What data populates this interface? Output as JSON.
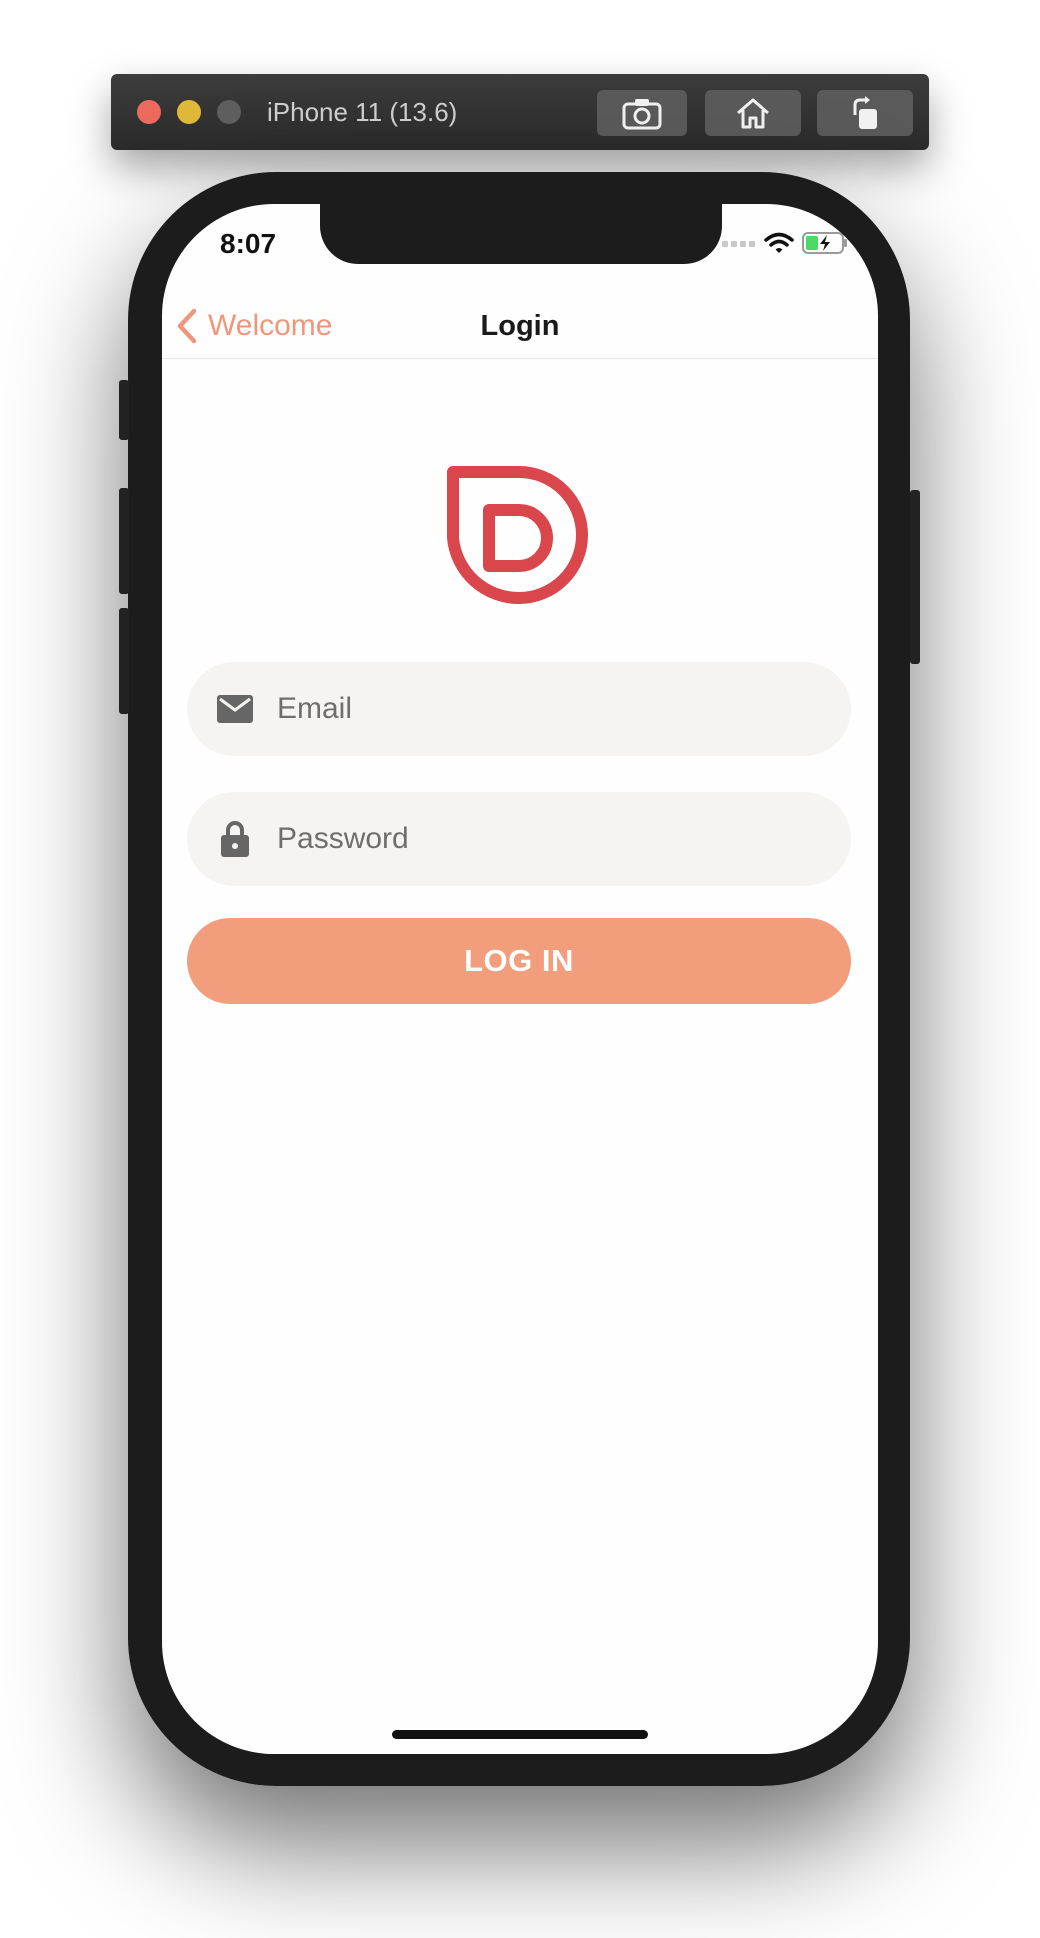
{
  "simulator": {
    "title": "iPhone 11 (13.6)",
    "buttons": [
      {
        "icon": "screenshot-icon"
      },
      {
        "icon": "home-icon"
      },
      {
        "icon": "rotate-icon"
      }
    ]
  },
  "status_bar": {
    "time": "8:07",
    "icons": [
      "cellular-icon",
      "wifi-icon",
      "battery-charging-icon"
    ]
  },
  "nav": {
    "back_label": "Welcome",
    "title": "Login"
  },
  "form": {
    "email_placeholder": "Email",
    "email_value": "",
    "password_placeholder": "Password",
    "password_value": "",
    "login_label": "LOG IN"
  },
  "colors": {
    "accent": "#f29e7c",
    "back_link": "#f0967a",
    "logo": "#d9474d",
    "field_bg": "#f5f4f2",
    "frame": "#1c1c1c"
  }
}
